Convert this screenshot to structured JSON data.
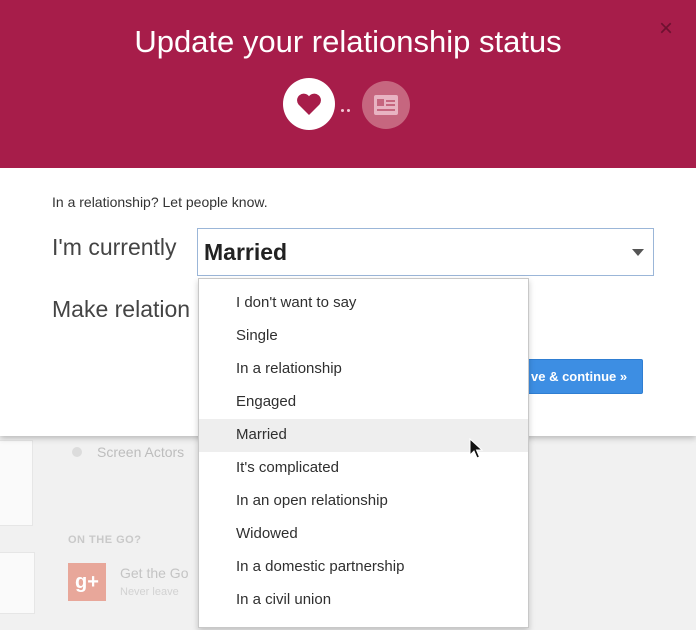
{
  "background": {
    "screen_actors": "Screen Actors",
    "on_the_go": "ON THE GO?",
    "gplus_icon": "g+",
    "get_the_go": "Get the Go",
    "never_leave": "Never leave"
  },
  "modal": {
    "title": "Update your relationship status",
    "close_label": "×",
    "intro": "In a relationship? Let people know.",
    "currently_label": "I'm currently",
    "selected_status": "Married",
    "make_relation_label": "Make relation",
    "save_button": "ve & continue »",
    "accent_color": "#a71d4a",
    "button_color": "#3d8ee3"
  },
  "dropdown": {
    "options": [
      "I don't want to say",
      "Single",
      "In a relationship",
      "Engaged",
      "Married",
      "It's complicated",
      "In an open relationship",
      "Widowed",
      "In a domestic partnership",
      "In a civil union"
    ],
    "highlighted": "Married"
  }
}
